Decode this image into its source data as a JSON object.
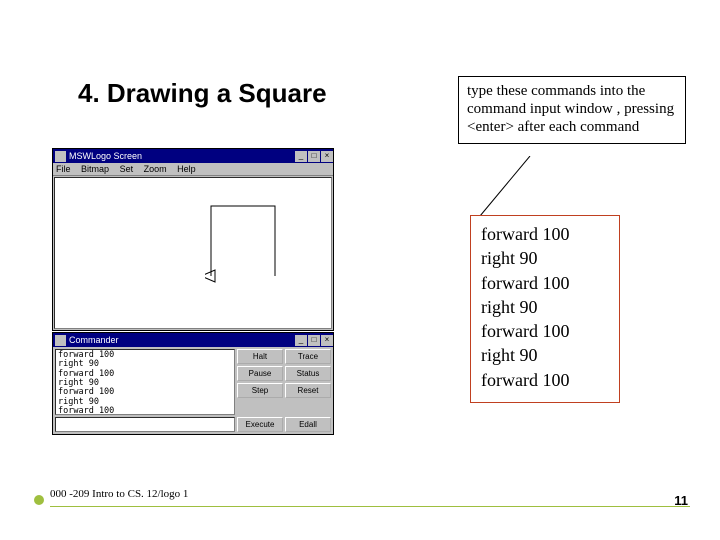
{
  "title": "4. Drawing a Square",
  "footer": {
    "left": "000 -209 Intro to CS. 12/logo 1",
    "page": "11"
  },
  "instruction": "type these commands into the command input window , pressing <enter> after each command",
  "commands": "forward 100\nright 90\nforward 100\nright 90\nforward 100\nright 90\nforward 100",
  "app": {
    "main_title": "MSWLogo Screen",
    "menu": {
      "file": "File",
      "bitmap": "Bitmap",
      "set": "Set",
      "zoom": "Zoom",
      "help": "Help"
    },
    "commander_title": "Commander",
    "history": "forward 100\nright 90\nforward 100\nright 90\nforward 100\nright 90\nforward 100",
    "buttons": {
      "halt": "Halt",
      "trace": "Trace",
      "pause": "Pause",
      "status": "Status",
      "step": "Step",
      "reset": "Reset",
      "execute": "Execute",
      "edall": "Edall"
    }
  }
}
